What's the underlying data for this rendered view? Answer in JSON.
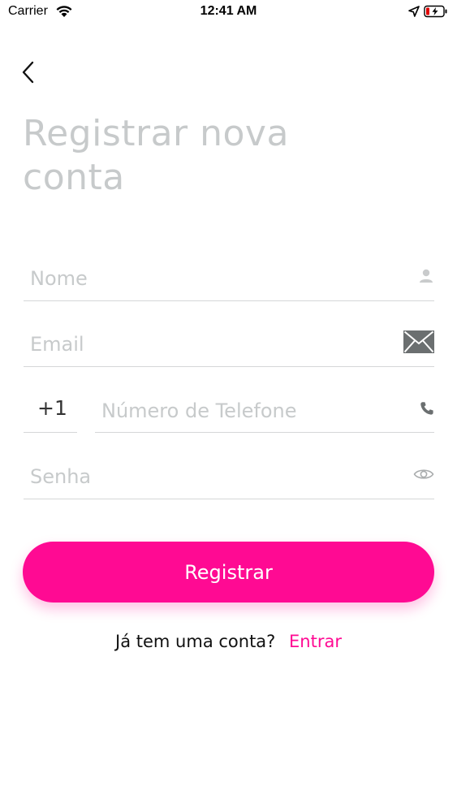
{
  "status_bar": {
    "carrier": "Carrier",
    "time": "12:41 AM",
    "icons": [
      "wifi-icon",
      "location-arrow-icon",
      "battery-charging-icon"
    ]
  },
  "nav": {
    "back_icon": "chevron-left-icon"
  },
  "page": {
    "title": "Registrar nova conta"
  },
  "form": {
    "name": {
      "value": "",
      "placeholder": "Nome",
      "icon": "person-icon"
    },
    "email": {
      "value": "",
      "placeholder": "Email",
      "icon": "envelope-icon"
    },
    "phone": {
      "country_code": "+1",
      "value": "",
      "placeholder": "Número de Telefone",
      "icon": "phone-icon"
    },
    "password": {
      "value": "",
      "placeholder": "Senha",
      "icon": "eye-icon"
    }
  },
  "actions": {
    "register_label": "Registrar"
  },
  "footer": {
    "prompt": "Já tem uma conta?",
    "login_label": "Entrar"
  },
  "colors": {
    "accent": "#ff0a93",
    "placeholder": "#c7cacb",
    "divider": "#d5d7d8"
  }
}
